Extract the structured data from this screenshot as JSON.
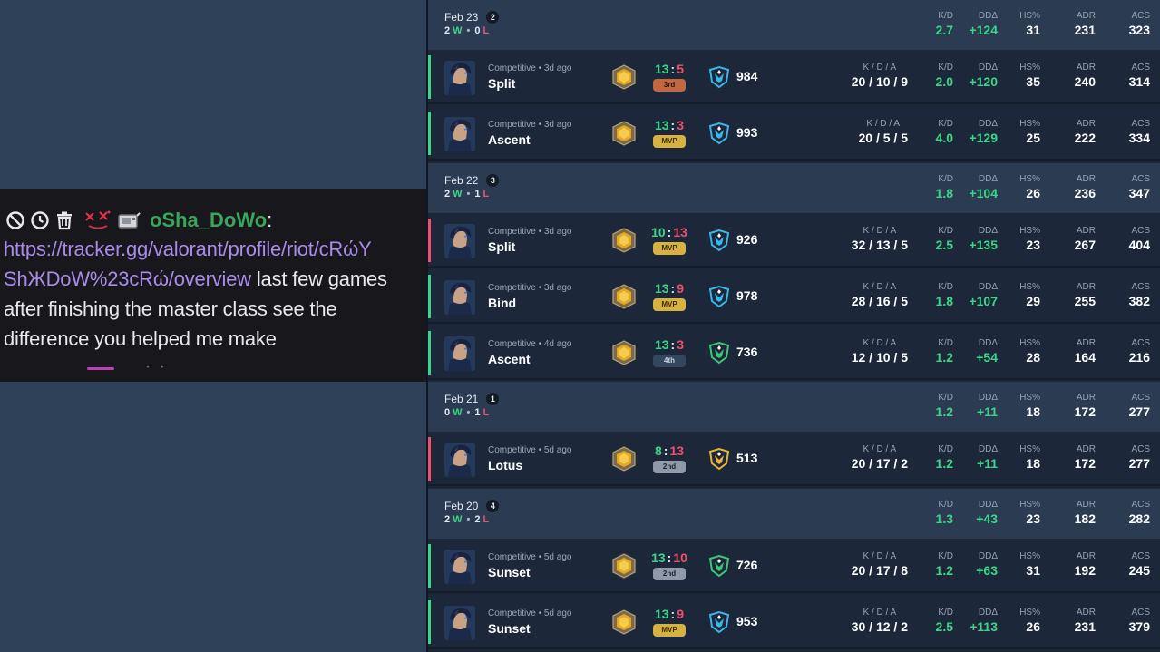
{
  "chat": {
    "username": "oSha_DoWo",
    "colon": ":",
    "link_text": "https://tracker.gg/valorant/profile/riot/cRώY ShЖDoW%23cRώ/overview",
    "message": " last few games after finishing the master class see the difference you helped me make",
    "badges": [
      "ban-icon",
      "timeout-icon",
      "delete-icon",
      "emote-icon",
      "chat-badge-icon"
    ]
  },
  "stat_headers": {
    "kda": "K / D / A",
    "kd": "K/D",
    "dd": "DDΔ",
    "hs": "HS%",
    "adr": "ADR",
    "acs": "ACS"
  },
  "days": [
    {
      "date": "Feb 23",
      "count": "2",
      "wins": "2",
      "w": "W",
      "sep": "•",
      "losses": "0",
      "l": "L",
      "kd": "2.7",
      "dd": "+124",
      "hs": "31",
      "adr": "231",
      "acs": "323",
      "matches": [
        {
          "mode": "Competitive • 3d ago",
          "map": "Split",
          "sw": "13",
          "colon": ":",
          "sl": "5",
          "place": "3rd",
          "place_type": "p3",
          "rr": "984",
          "kda": "20 / 10 / 9",
          "kd": "2.0",
          "dd": "+120",
          "hs": "35",
          "adr": "240",
          "acs": "314",
          "result": "win",
          "rank_color": "#3ab6e8"
        },
        {
          "mode": "Competitive • 3d ago",
          "map": "Ascent",
          "sw": "13",
          "colon": ":",
          "sl": "3",
          "place": "MVP",
          "place_type": "mvp",
          "rr": "993",
          "kda": "20 / 5 / 5",
          "kd": "4.0",
          "dd": "+129",
          "hs": "25",
          "adr": "222",
          "acs": "334",
          "result": "win",
          "rank_color": "#3ab6e8"
        }
      ]
    },
    {
      "date": "Feb 22",
      "count": "3",
      "wins": "2",
      "w": "W",
      "sep": "•",
      "losses": "1",
      "l": "L",
      "kd": "1.8",
      "dd": "+104",
      "hs": "26",
      "adr": "236",
      "acs": "347",
      "matches": [
        {
          "mode": "Competitive • 3d ago",
          "map": "Split",
          "sw": "10",
          "colon": ":",
          "sl": "13",
          "place": "MVP",
          "place_type": "mvp",
          "rr": "926",
          "kda": "32 / 13 / 5",
          "kd": "2.5",
          "dd": "+135",
          "hs": "23",
          "adr": "267",
          "acs": "404",
          "result": "loss",
          "rank_color": "#3ab6e8"
        },
        {
          "mode": "Competitive • 3d ago",
          "map": "Bind",
          "sw": "13",
          "colon": ":",
          "sl": "9",
          "place": "MVP",
          "place_type": "mvp",
          "rr": "978",
          "kda": "28 / 16 / 5",
          "kd": "1.8",
          "dd": "+107",
          "hs": "29",
          "adr": "255",
          "acs": "382",
          "result": "win",
          "rank_color": "#3ab6e8"
        },
        {
          "mode": "Competitive • 4d ago",
          "map": "Ascent",
          "sw": "13",
          "colon": ":",
          "sl": "3",
          "place": "4th",
          "place_type": "p4",
          "rr": "736",
          "kda": "12 / 10 / 5",
          "kd": "1.2",
          "dd": "+54",
          "hs": "28",
          "adr": "164",
          "acs": "216",
          "result": "win",
          "rank_color": "#3cc67a"
        }
      ]
    },
    {
      "date": "Feb 21",
      "count": "1",
      "wins": "0",
      "w": "W",
      "sep": "•",
      "losses": "1",
      "l": "L",
      "kd": "1.2",
      "dd": "+11",
      "hs": "18",
      "adr": "172",
      "acs": "277",
      "matches": [
        {
          "mode": "Competitive • 5d ago",
          "map": "Lotus",
          "sw": "8",
          "colon": ":",
          "sl": "13",
          "place": "2nd",
          "place_type": "p2",
          "rr": "513",
          "kda": "20 / 17 / 2",
          "kd": "1.2",
          "dd": "+11",
          "hs": "18",
          "adr": "172",
          "acs": "277",
          "result": "loss",
          "rank_color": "#e8b33a"
        }
      ]
    },
    {
      "date": "Feb 20",
      "count": "4",
      "wins": "2",
      "w": "W",
      "sep": "•",
      "losses": "2",
      "l": "L",
      "kd": "1.3",
      "dd": "+43",
      "hs": "23",
      "adr": "182",
      "acs": "282",
      "matches": [
        {
          "mode": "Competitive • 5d ago",
          "map": "Sunset",
          "sw": "13",
          "colon": ":",
          "sl": "10",
          "place": "2nd",
          "place_type": "p2",
          "rr": "726",
          "kda": "20 / 17 / 8",
          "kd": "1.2",
          "dd": "+63",
          "hs": "31",
          "adr": "192",
          "acs": "245",
          "result": "win",
          "rank_color": "#3cc67a"
        },
        {
          "mode": "Competitive • 5d ago",
          "map": "Sunset",
          "sw": "13",
          "colon": ":",
          "sl": "9",
          "place": "MVP",
          "place_type": "mvp",
          "rr": "953",
          "kda": "30 / 12 / 2",
          "kd": "2.5",
          "dd": "+113",
          "hs": "26",
          "adr": "231",
          "acs": "379",
          "result": "win",
          "rank_color": "#3ab6e8"
        }
      ]
    }
  ]
}
